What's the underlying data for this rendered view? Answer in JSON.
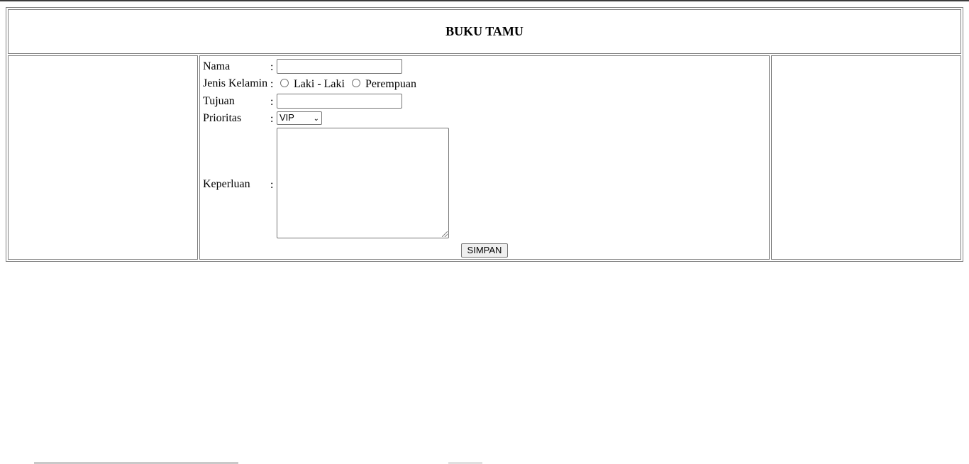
{
  "page": {
    "title": "BUKU TAMU"
  },
  "form": {
    "nama_label": "Nama",
    "nama_value": "",
    "jenis_kelamin_label": "Jenis Kelamin",
    "gender_options": [
      "Laki - Laki",
      "Perempuan"
    ],
    "tujuan_label": "Tujuan",
    "tujuan_value": "",
    "prioritas_label": "Prioritas",
    "prioritas_selected": "VIP",
    "keperluan_label": "Keperluan",
    "keperluan_value": "",
    "colon": ":",
    "submit_label": "SIMPAN"
  },
  "icons": {
    "select_arrow": "chevron-down-icon",
    "textarea_resize": "resize-grip-icon"
  }
}
